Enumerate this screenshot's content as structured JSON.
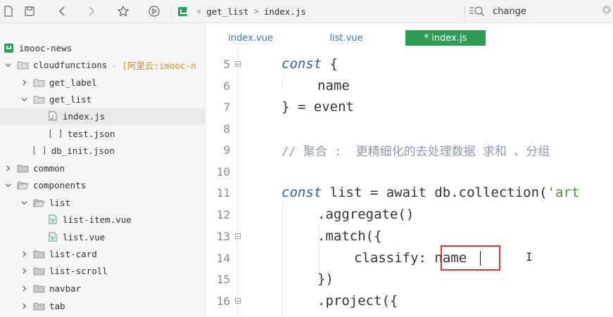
{
  "breadcrumb": {
    "sep1": "«",
    "path1": "get_list",
    "sep2": ">",
    "path2": "index.js"
  },
  "search": {
    "value": "change"
  },
  "sidebar": {
    "items": [
      {
        "label": "imooc-news"
      },
      {
        "label": "cloudfunctions",
        "annotation": "- [阿里云:imooc-n"
      },
      {
        "label": "get_label"
      },
      {
        "label": "get_list"
      },
      {
        "label": "index.js"
      },
      {
        "label": "test.json",
        "icon_text": "[ ]"
      },
      {
        "label": "db_init.json",
        "icon_text": "[ ]"
      },
      {
        "label": "common"
      },
      {
        "label": "components"
      },
      {
        "label": "list"
      },
      {
        "label": "list-item.vue"
      },
      {
        "label": "list.vue"
      },
      {
        "label": "list-card"
      },
      {
        "label": "list-scroll"
      },
      {
        "label": "navbar"
      },
      {
        "label": "tab"
      }
    ]
  },
  "tabs": [
    {
      "label": "index.vue"
    },
    {
      "label": "list.vue"
    },
    {
      "label": "* index.js"
    }
  ],
  "code": {
    "lines": [
      {
        "n": "5",
        "t1": "const",
        "t2": " {"
      },
      {
        "n": "6",
        "t1": "name"
      },
      {
        "n": "7",
        "t1": "} = event"
      },
      {
        "n": "8"
      },
      {
        "n": "9",
        "t1": "// 聚合 :  更精细化的去处理数据 求和 、分组"
      },
      {
        "n": "10"
      },
      {
        "n": "11",
        "t1": "const",
        "t2": " list = await db.collection(",
        "t3": "'art"
      },
      {
        "n": "12",
        "t1": ".aggregate()"
      },
      {
        "n": "13",
        "t1": ".match({"
      },
      {
        "n": "14",
        "t1": "classify: ",
        "t2": "name"
      },
      {
        "n": "15",
        "t1": "})"
      },
      {
        "n": "16",
        "t1": ".project({"
      }
    ]
  },
  "colors": {
    "active_tab": "#2f9c55",
    "keyword": "#2e5ab0",
    "highlight_box": "#e53030"
  }
}
